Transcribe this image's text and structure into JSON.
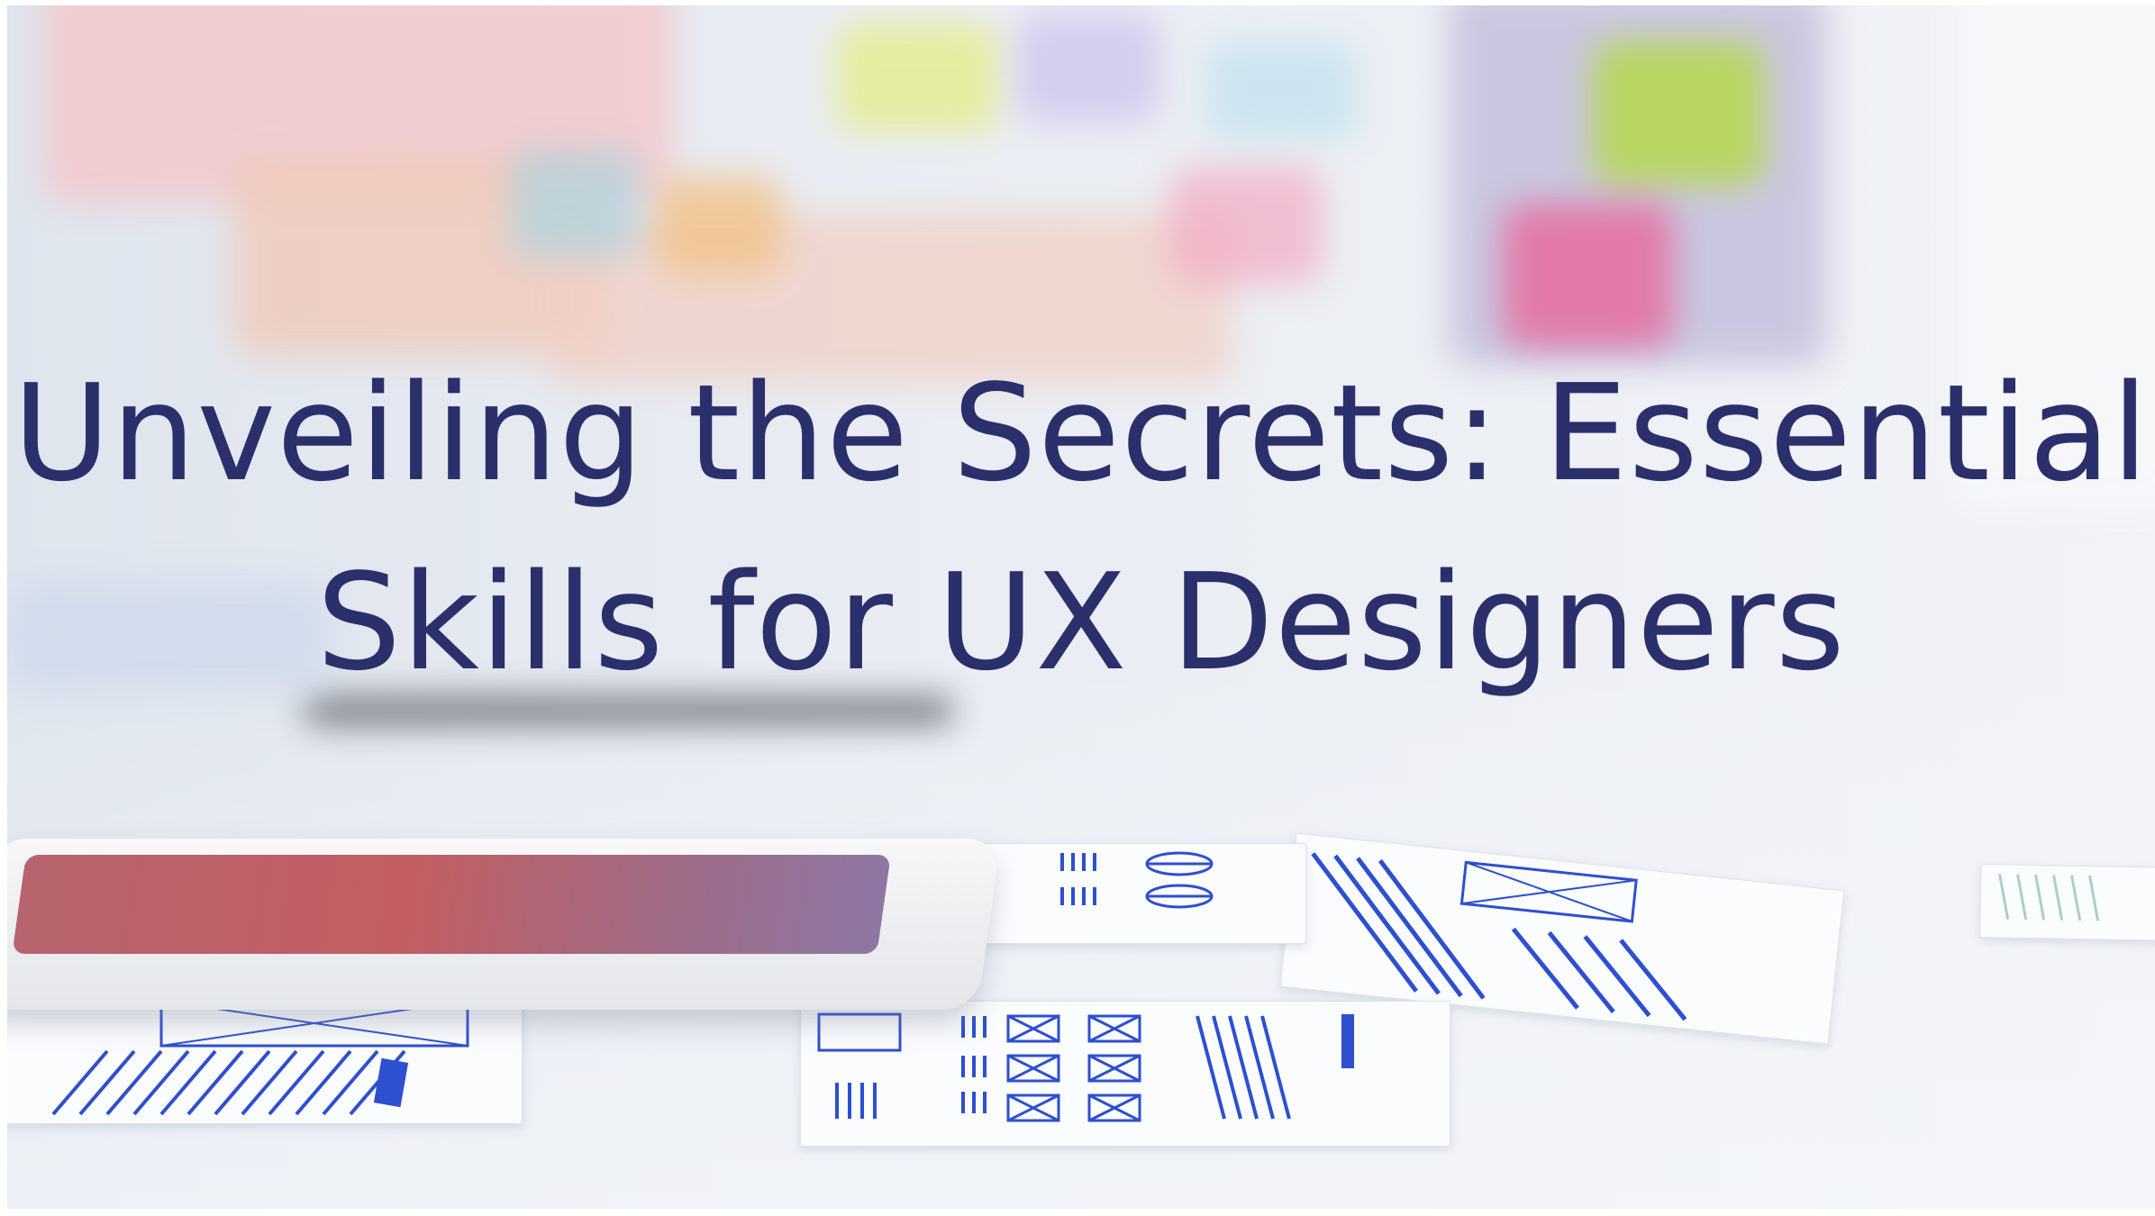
{
  "image": {
    "description_alt": "",
    "title_lines": [
      "Unveiling the Secrets: Essential",
      "Skills for UX Designers"
    ]
  },
  "colors": {
    "title": "#2b2f6b",
    "sketch_blue": "#2d4fd0",
    "tablet_screen": "#c35f63"
  }
}
